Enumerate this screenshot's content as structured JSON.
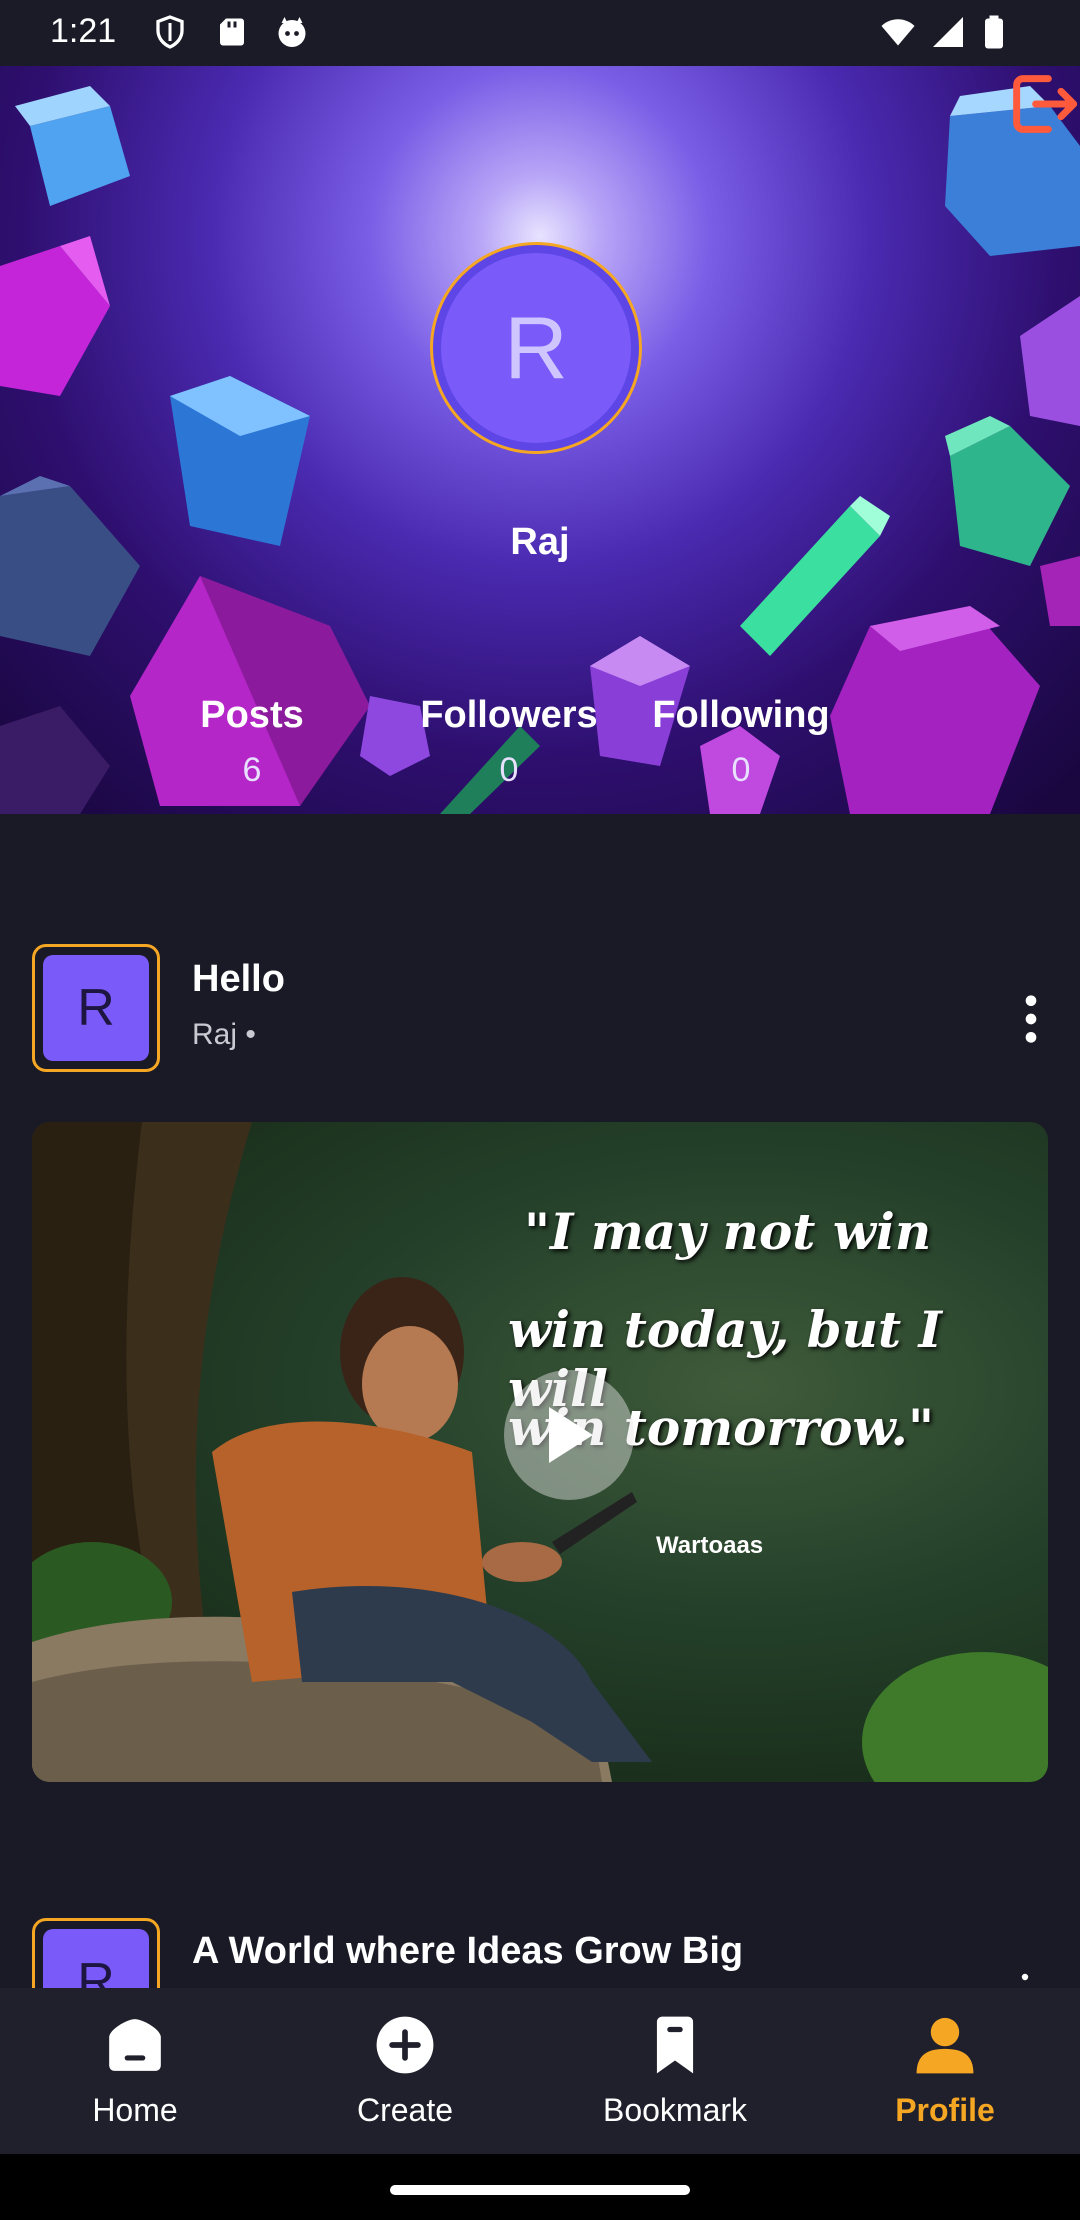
{
  "status_bar": {
    "time": "1:21"
  },
  "profile": {
    "name": "Raj",
    "avatar_letter": "R",
    "stats": [
      {
        "label": "Posts",
        "value": "6"
      },
      {
        "label": "Followers",
        "value": "0"
      },
      {
        "label": "Following",
        "value": "0"
      }
    ]
  },
  "posts": [
    {
      "title": "Hello",
      "author": "Raj •",
      "avatar_letter": "R",
      "media_quote_lines": [
        "\"I  may not win",
        "win  today, but I will",
        "win tomorrow.\""
      ],
      "media_watermark": "Wartoaas"
    },
    {
      "title": "A World where Ideas Grow Big",
      "avatar_letter": "R"
    }
  ],
  "bottom_nav": {
    "items": [
      {
        "label": "Home",
        "icon": "home-icon"
      },
      {
        "label": "Create",
        "icon": "add-circle-icon"
      },
      {
        "label": "Bookmark",
        "icon": "bookmark-icon"
      },
      {
        "label": "Profile",
        "icon": "profile-icon",
        "active": true
      }
    ]
  },
  "colors": {
    "accent": "#f5a623",
    "avatar": "#7a5af8",
    "background": "#1a1a26"
  }
}
